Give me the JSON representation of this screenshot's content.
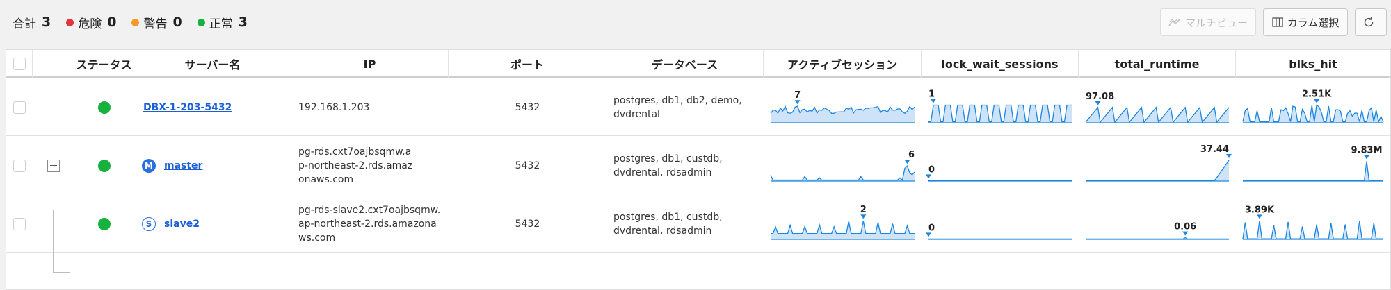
{
  "summary": {
    "total_label": "合計",
    "total": "3",
    "danger_label": "危険",
    "danger": "0",
    "warning_label": "警告",
    "warning": "0",
    "normal_label": "正常",
    "normal": "3",
    "colors": {
      "danger": "#e0353b",
      "warning": "#f59a23",
      "normal": "#17b13d"
    }
  },
  "toolbar": {
    "multiview_label": "マルチビュー",
    "column_select_label": "カラム選択",
    "refresh_icon": "refresh-icon"
  },
  "columns": {
    "status": "ステータス",
    "server_name": "サーバー名",
    "ip": "IP",
    "port": "ポート",
    "database": "データベース",
    "active_sessions": "アクティブセッション",
    "lock_wait_sessions": "lock_wait_sessions",
    "total_runtime": "total_runtime",
    "blks_hit": "blks_hit"
  },
  "rows": [
    {
      "name": "DBX-1-203-5432",
      "role": "",
      "ip": "192.168.1.203",
      "port": "5432",
      "databases": "postgres, db1, db2, demo, dvdrental",
      "active_peak": "7",
      "lock_peak": "1",
      "runtime_peak": "97.08",
      "blks_peak": "2.51K"
    },
    {
      "name": "master",
      "role": "M",
      "ip": "pg-rds.cxt7oajbsqmw.ap-northeast-2.rds.amazonaws.com",
      "port": "5432",
      "databases": "postgres, db1, custdb, dvdrental, rdsadmin",
      "active_peak": "6",
      "lock_peak": "0",
      "runtime_peak": "37.44",
      "blks_peak": "9.83M"
    },
    {
      "name": "slave2",
      "role": "S",
      "ip": "pg-rds-slave2.cxt7oajbsqmw.ap-northeast-2.rds.amazonaws.com",
      "port": "5432",
      "databases": "postgres, db1, custdb, dvdrental, rdsadmin",
      "active_peak": "2",
      "lock_peak": "0",
      "runtime_peak": "0.06",
      "blks_peak": "3.89K"
    }
  ],
  "colors": {
    "accent": "#1a86e0",
    "spark_fill": "#cfe3f8",
    "link": "#1a5fd6",
    "status_normal": "#17b13d"
  }
}
